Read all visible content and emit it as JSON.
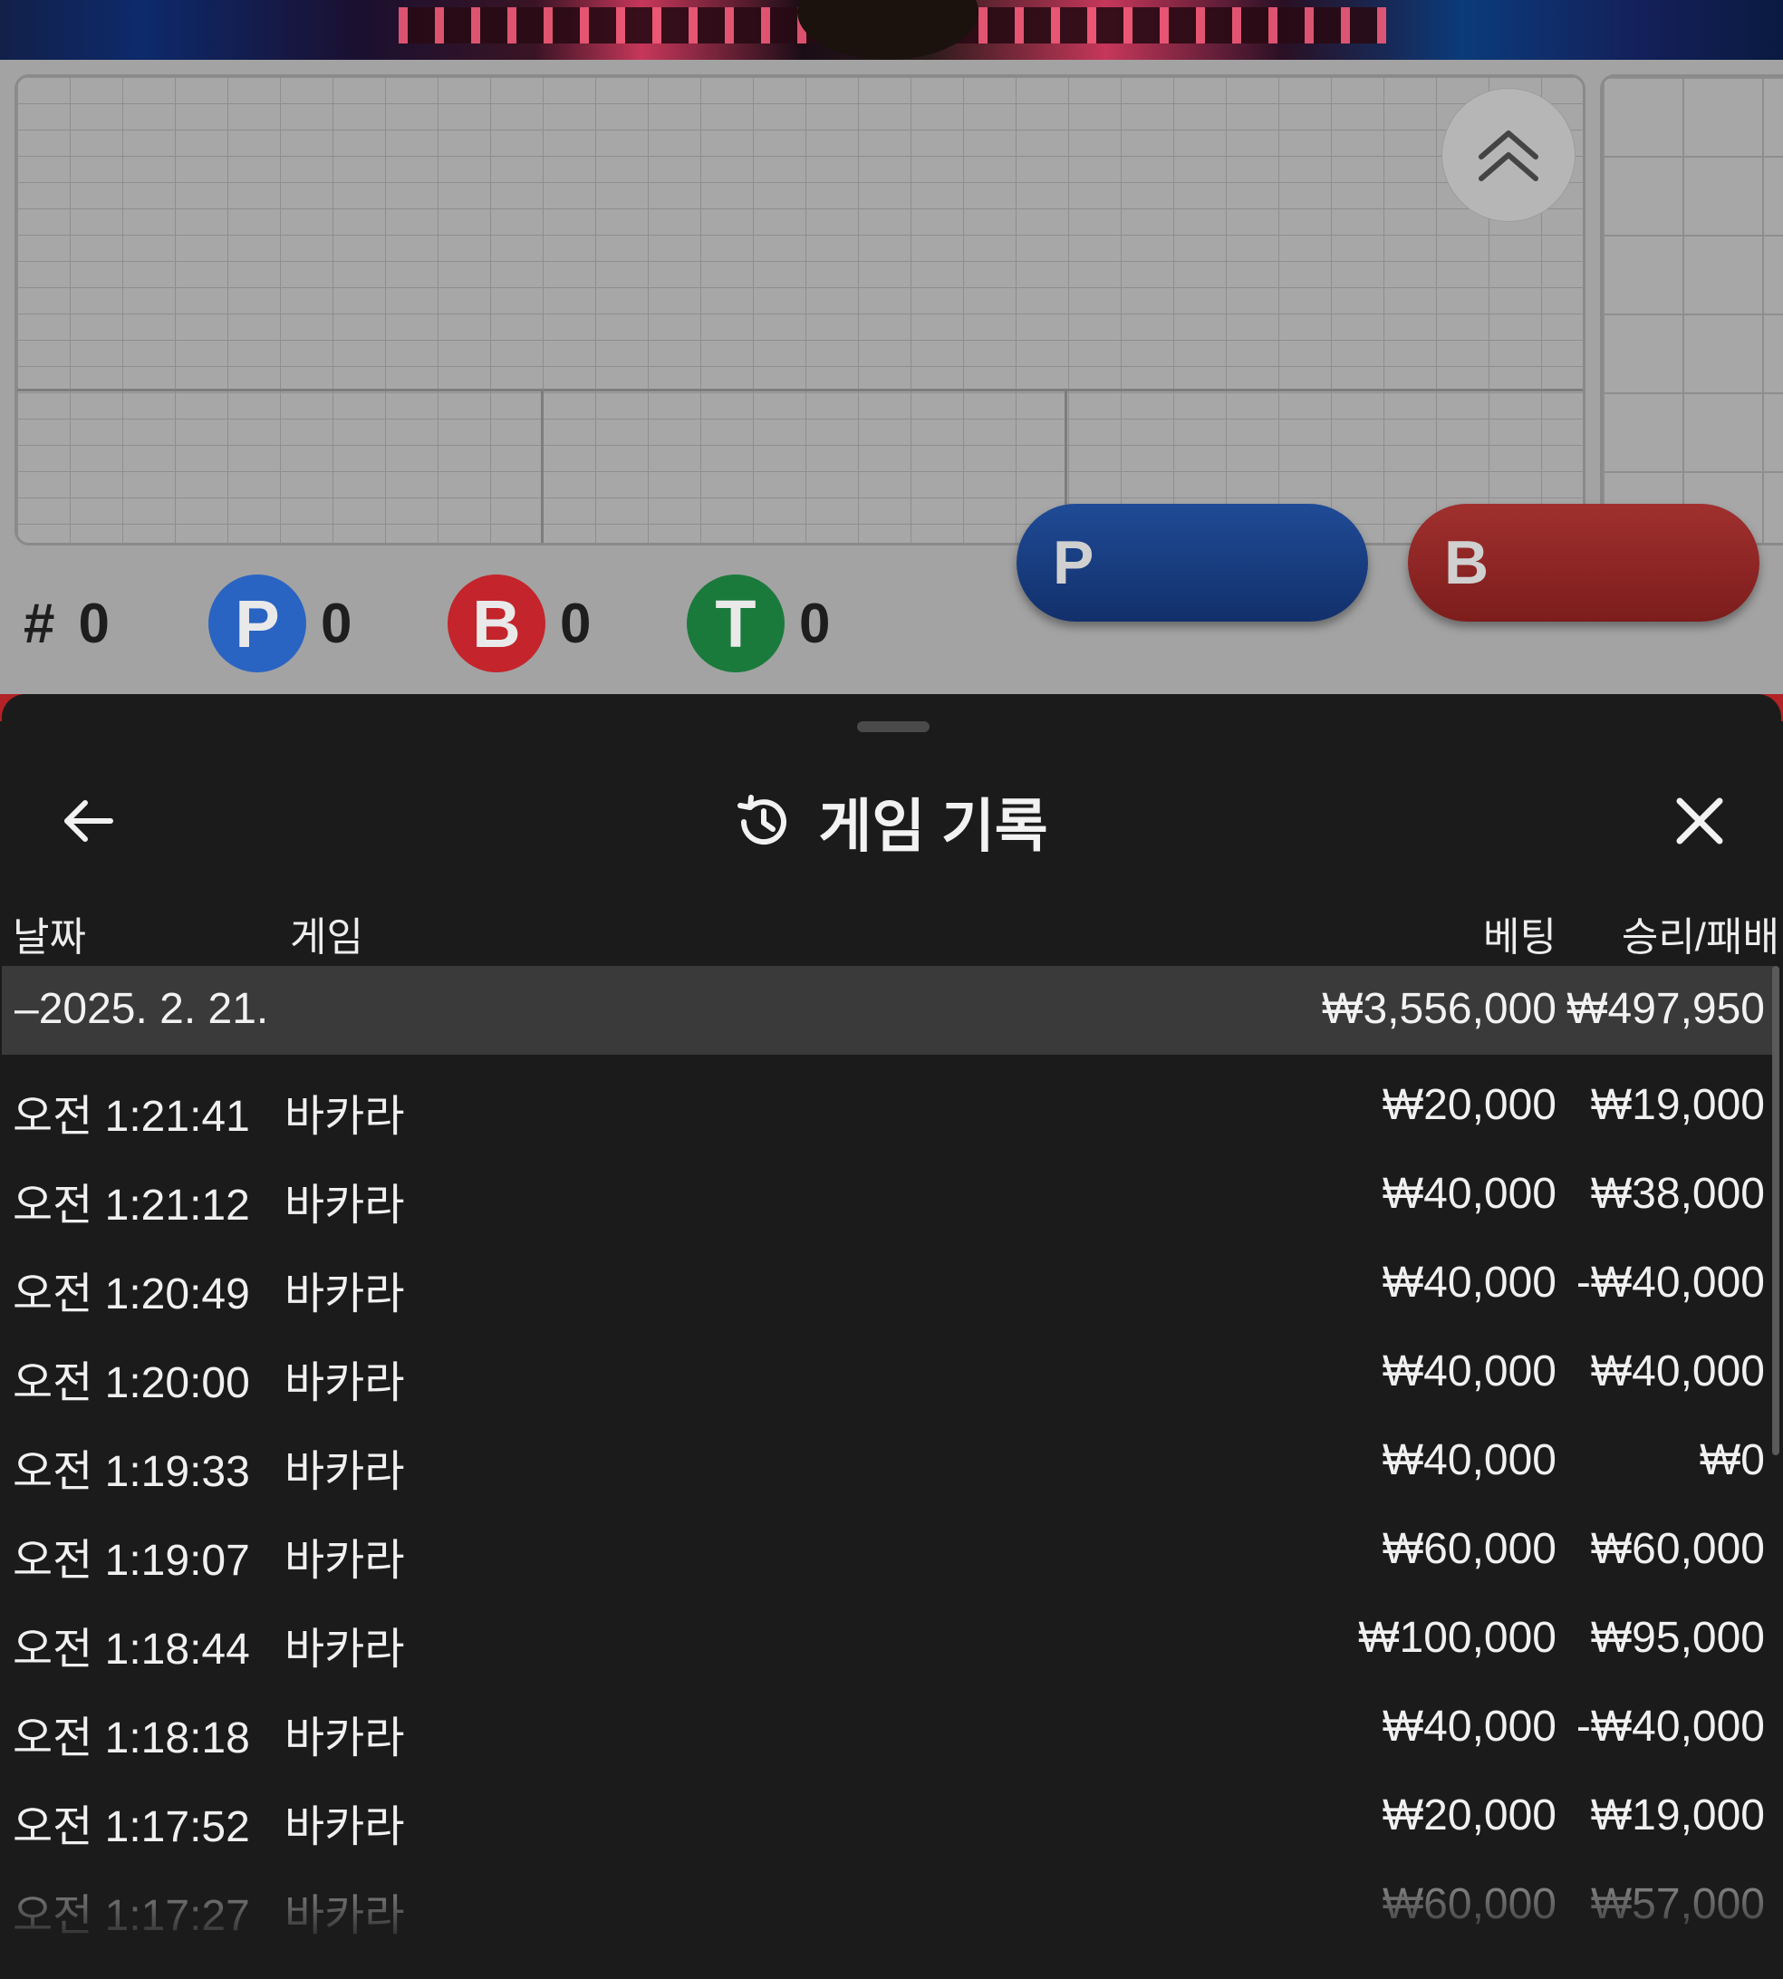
{
  "scoreboard": {
    "hash_label": "#",
    "hash_count": "0",
    "player_badge": "P",
    "player_count": "0",
    "banker_badge": "B",
    "banker_count": "0",
    "tie_badge": "T",
    "tie_count": "0",
    "player_button": "P",
    "banker_button": "B"
  },
  "colors": {
    "player": "#2a64c2",
    "banker": "#c4242b",
    "tie": "#1a7a3c",
    "sheet_bg": "#1b1b1b"
  },
  "history": {
    "title": "게임 기록",
    "title_icon": "history-icon",
    "back_icon": "arrow-left-icon",
    "close_icon": "close-icon",
    "columns": {
      "date": "날짜",
      "game": "게임",
      "bet": "베팅",
      "result": "승리/패배"
    },
    "date_group": {
      "date": "–2025. 2. 21.",
      "total_bet": "₩3,556,000",
      "total_result": "₩497,950"
    },
    "rows": [
      {
        "time": "오전 1:21:41",
        "game": "바카라",
        "bet": "₩20,000",
        "result": "₩19,000"
      },
      {
        "time": "오전 1:21:12",
        "game": "바카라",
        "bet": "₩40,000",
        "result": "₩38,000"
      },
      {
        "time": "오전 1:20:49",
        "game": "바카라",
        "bet": "₩40,000",
        "result": "-₩40,000"
      },
      {
        "time": "오전 1:20:00",
        "game": "바카라",
        "bet": "₩40,000",
        "result": "₩40,000"
      },
      {
        "time": "오전 1:19:33",
        "game": "바카라",
        "bet": "₩40,000",
        "result": "₩0"
      },
      {
        "time": "오전 1:19:07",
        "game": "바카라",
        "bet": "₩60,000",
        "result": "₩60,000"
      },
      {
        "time": "오전 1:18:44",
        "game": "바카라",
        "bet": "₩100,000",
        "result": "₩95,000"
      },
      {
        "time": "오전 1:18:18",
        "game": "바카라",
        "bet": "₩40,000",
        "result": "-₩40,000"
      },
      {
        "time": "오전 1:17:52",
        "game": "바카라",
        "bet": "₩20,000",
        "result": "₩19,000"
      },
      {
        "time": "오전 1:17:27",
        "game": "바카라",
        "bet": "₩60,000",
        "result": "₩57,000"
      }
    ]
  }
}
